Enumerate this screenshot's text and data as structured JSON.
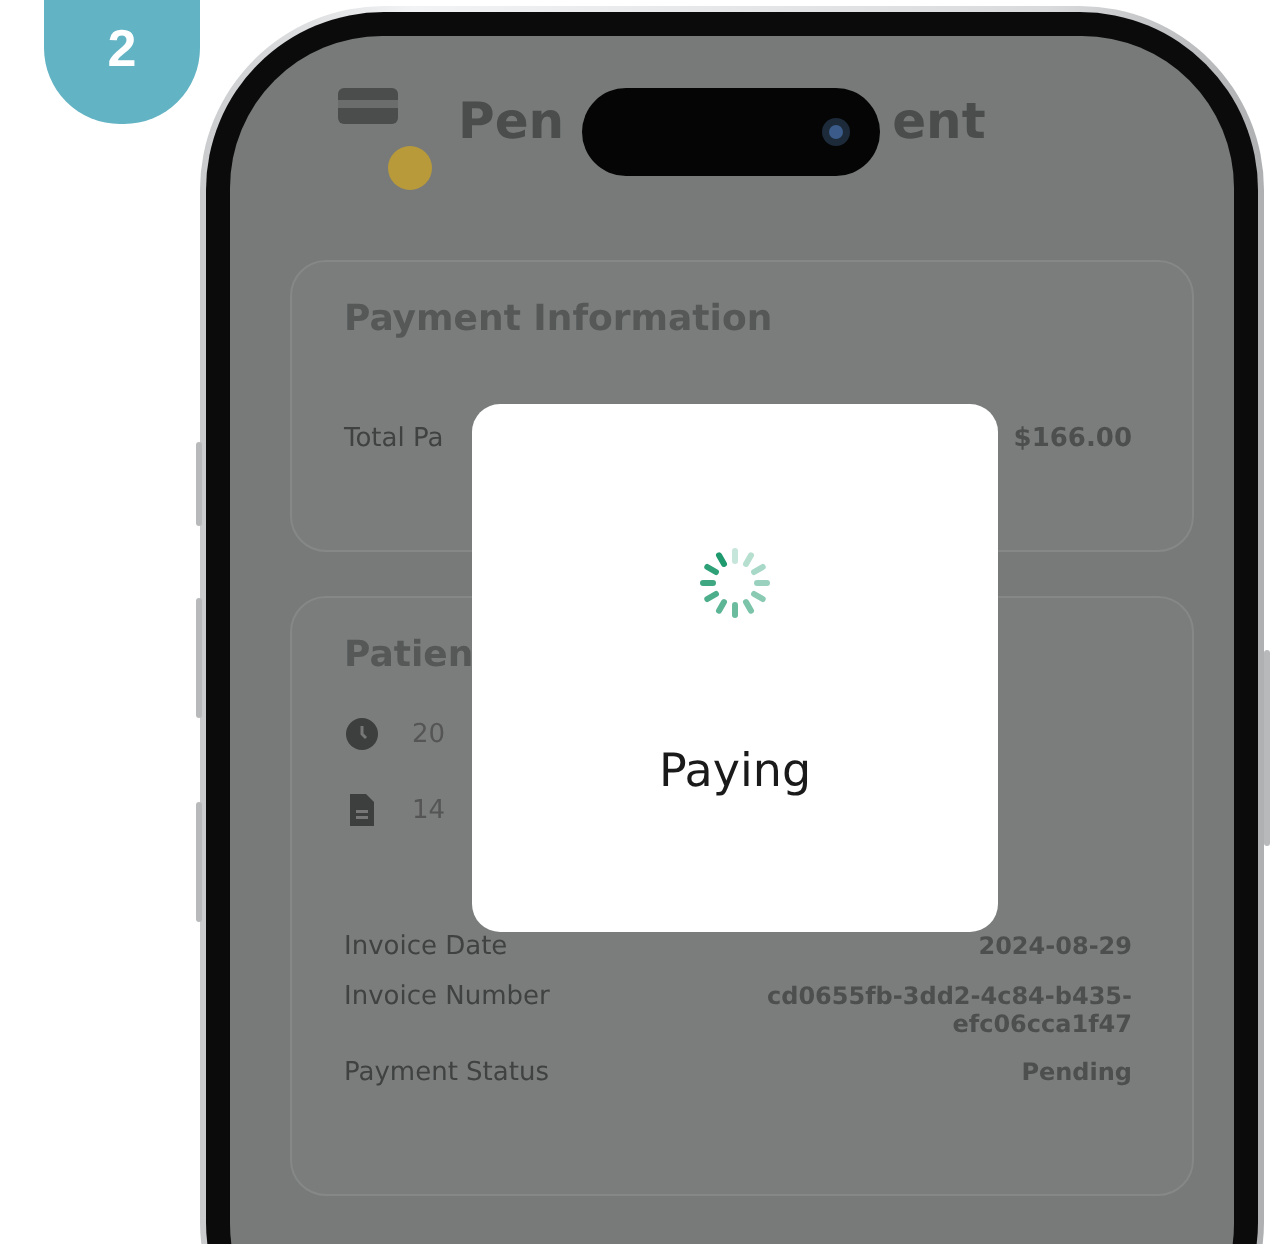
{
  "badge": "2",
  "header": {
    "title_parts": [
      "Pen",
      "ent"
    ]
  },
  "payment_card": {
    "title": "Payment Information",
    "rows": [
      {
        "label": "Total Pa",
        "value": "$166.00"
      }
    ]
  },
  "patient_card": {
    "title": "Patien",
    "items": [
      {
        "kind": "clock",
        "text": "20"
      },
      {
        "kind": "document",
        "text": "14"
      }
    ],
    "details": [
      {
        "label": "Invoice Date",
        "value": "2024-08-29"
      },
      {
        "label": "Invoice Number",
        "value": "cd0655fb-3dd2-4c84-b435-efc06cca1f47"
      },
      {
        "label": "Payment Status",
        "value": "Pending"
      }
    ]
  },
  "dialog": {
    "message": "Paying"
  }
}
